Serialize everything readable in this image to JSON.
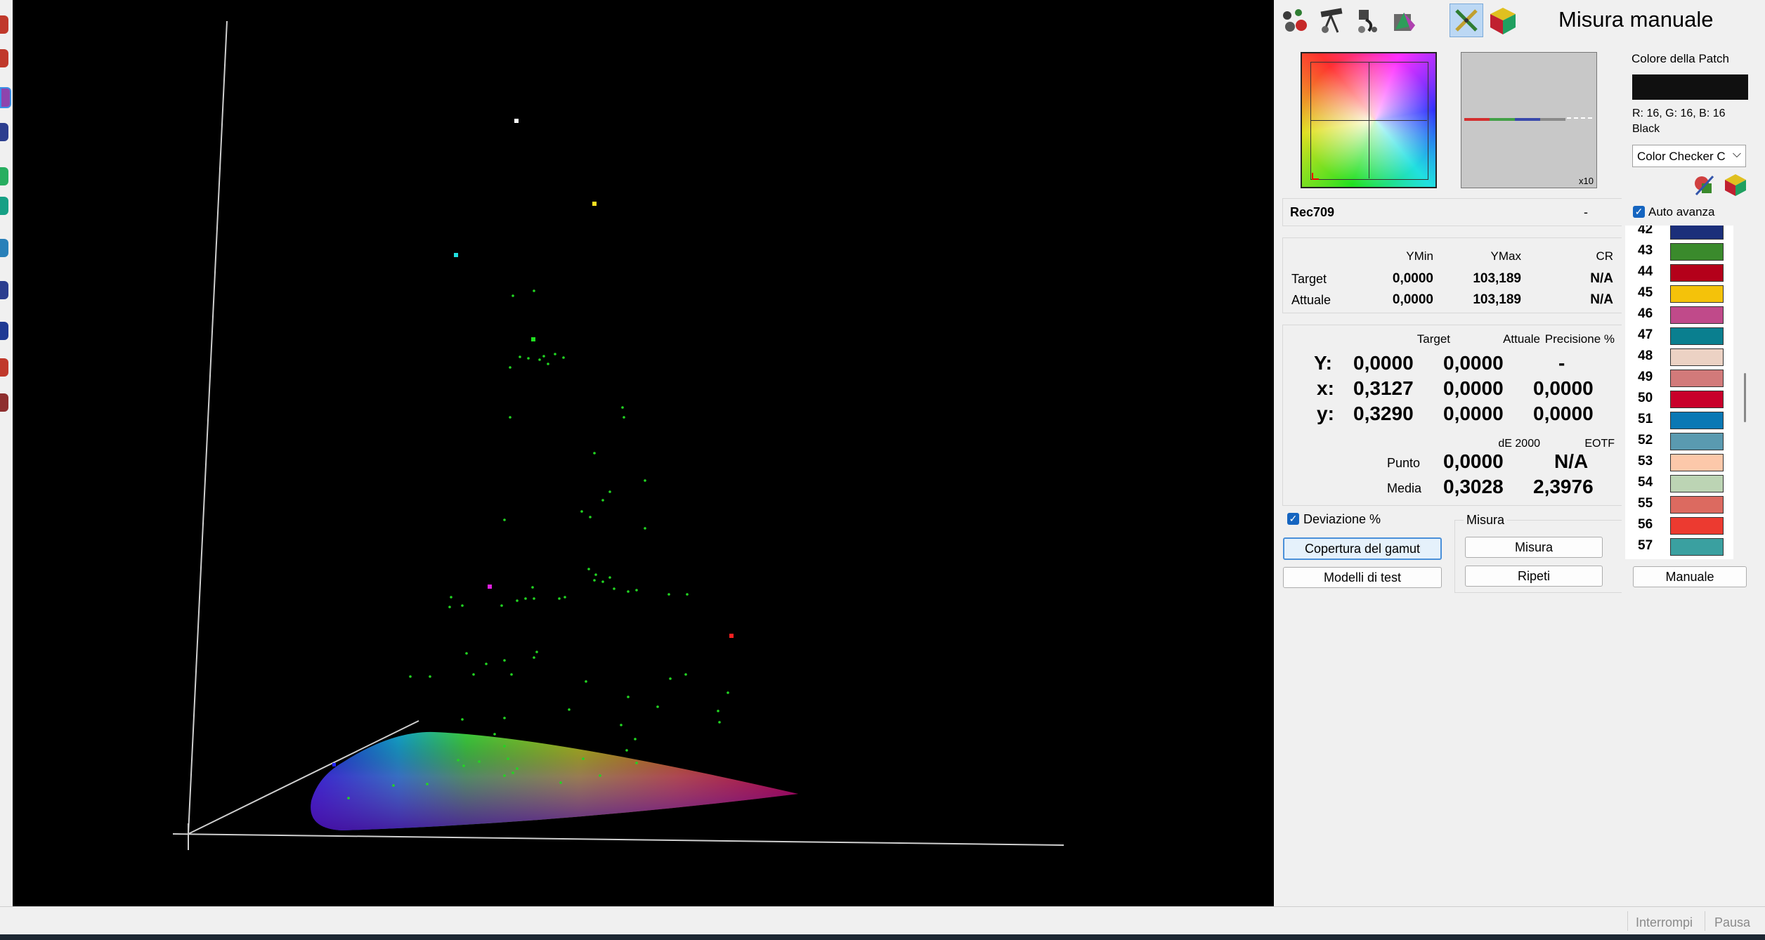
{
  "title": "Misura manuale",
  "toolbar": {
    "icons": [
      "colored-dots-icon",
      "telescope-icon",
      "probe-icon",
      "gamut-box-icon",
      "pencil-icon",
      "rgb-cube-icon"
    ]
  },
  "colorspace": {
    "name": "Rec709",
    "value": "-"
  },
  "graph": {
    "zoom_label": "x10"
  },
  "luminance": {
    "headers": [
      "YMin",
      "YMax",
      "CR"
    ],
    "rows": [
      {
        "label": "Target",
        "ymin": "0,0000",
        "ymax": "103,189",
        "cr": "N/A"
      },
      {
        "label": "Attuale",
        "ymin": "0,0000",
        "ymax": "103,189",
        "cr": "N/A"
      }
    ]
  },
  "measure": {
    "headers": [
      "Target",
      "Attuale",
      "Precisione %"
    ],
    "rows": [
      {
        "label": "Y:",
        "target": "0,0000",
        "actual": "0,0000",
        "precision": "-"
      },
      {
        "label": "x:",
        "target": "0,3127",
        "actual": "0,0000",
        "precision": "0,0000"
      },
      {
        "label": "y:",
        "target": "0,3290",
        "actual": "0,0000",
        "precision": "0,0000"
      }
    ],
    "de_headers": [
      "dE 2000",
      "EOTF"
    ],
    "de_rows": [
      {
        "label": "Punto",
        "de": "0,0000",
        "eotf": "N/A"
      },
      {
        "label": "Media",
        "de": "0,3028",
        "eotf": "2,3976"
      }
    ]
  },
  "controls": {
    "deviation_label": "Deviazione %",
    "deviation_checked": true,
    "gamut_button": "Copertura del gamut",
    "test_models_button": "Modelli di test",
    "misura_group": "Misura",
    "measure_button": "Misura",
    "repeat_button": "Ripeti"
  },
  "patch": {
    "group_label": "Colore della Patch",
    "swatch_color": "#101010",
    "rgb_text": "R: 16, G: 16, B: 16",
    "name": "Black",
    "dropdown_value": "Color Checker C",
    "auto_advance_label": "Auto avanza",
    "auto_advance_checked": true,
    "manual_button": "Manuale",
    "items": [
      {
        "num": "42",
        "color": "#1b2f7a"
      },
      {
        "num": "43",
        "color": "#3a8a2c"
      },
      {
        "num": "44",
        "color": "#b4001a"
      },
      {
        "num": "45",
        "color": "#f4c20a"
      },
      {
        "num": "46",
        "color": "#c04a8a"
      },
      {
        "num": "47",
        "color": "#0a7f8f"
      },
      {
        "num": "48",
        "color": "#ecd2c4"
      },
      {
        "num": "49",
        "color": "#d27a7a"
      },
      {
        "num": "50",
        "color": "#c8002a"
      },
      {
        "num": "51",
        "color": "#0a78b4"
      },
      {
        "num": "52",
        "color": "#5a9ab0"
      },
      {
        "num": "53",
        "color": "#fcc8aa"
      },
      {
        "num": "54",
        "color": "#bcd4b4"
      },
      {
        "num": "55",
        "color": "#dc6a60"
      },
      {
        "num": "56",
        "color": "#ec3a30"
      },
      {
        "num": "57",
        "color": "#3aa0a0"
      }
    ]
  },
  "status": {
    "stop_button": "Interrompi",
    "pause_button": "Pausa"
  }
}
